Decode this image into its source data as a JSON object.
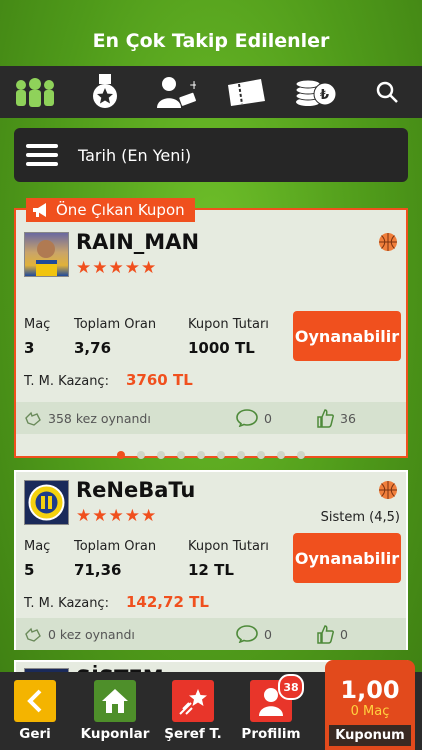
{
  "header": {
    "title": "En Çok Takip Edilenler"
  },
  "icons": [
    "users-icon",
    "medal-icon",
    "add-user-icon",
    "ticket-icon",
    "coins-icon",
    "search-icon"
  ],
  "sort": {
    "label": "Tarih (En Yeni)"
  },
  "cards": [
    {
      "featured_label": "Öne Çıkan Kupon",
      "username": "RAIN_MAN",
      "stars": "★★★★★",
      "system": "",
      "mac_label": "Maç",
      "mac": "3",
      "oran_label": "Toplam Oran",
      "oran": "3,76",
      "tutar_label": "Kupon Tutarı",
      "tutar": "1000 TL",
      "kazanc_label": "T. M. Kazanç:",
      "kazanc": "3760 TL",
      "play_label": "Oynanabilir",
      "played": "358 kez oynandı",
      "comments": "0",
      "likes": "36"
    },
    {
      "username": "ReNeBaTu",
      "stars": "★★★★★",
      "system": "Sistem (4,5)",
      "mac_label": "Maç",
      "mac": "5",
      "oran_label": "Toplam Oran",
      "oran": "71,36",
      "tutar_label": "Kupon Tutarı",
      "tutar": "12 TL",
      "kazanc_label": "T. M. Kazanç:",
      "kazanc": "142,72 TL",
      "play_label": "Oynanabilir",
      "played": "0 kez oynandı",
      "comments": "0",
      "likes": "0"
    }
  ],
  "partial_card": {
    "username": "SİSTEM"
  },
  "pagination": {
    "total": 10,
    "active": 1
  },
  "bottom": {
    "back": "Geri",
    "kuponlar": "Kuponlar",
    "seref": "Şeref T.",
    "profilim": "Profilim",
    "notif_count": "38",
    "kuponum_value": "1,00",
    "kuponum_mac": "0 Maç",
    "kuponum_label": "Kuponum"
  },
  "colors": {
    "accent": "#f0501e",
    "dark": "#2a2a2a",
    "green": "#4f9a1a"
  }
}
